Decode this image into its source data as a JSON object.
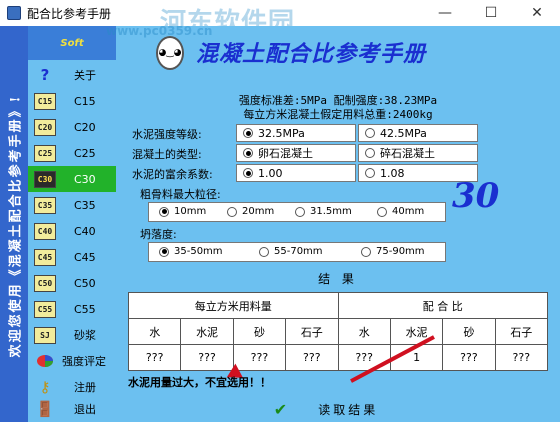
{
  "window": {
    "title": "配合比参考手册",
    "minimize": "—",
    "maximize": "☐",
    "close": "✕"
  },
  "watermark": {
    "text": "河东软件园",
    "url": "www.pc0359.cn"
  },
  "banner": {
    "text": "欢迎您使用《混凝土配合比参考手册》!"
  },
  "logo": {
    "text": "Soft"
  },
  "nav": [
    {
      "icon": "?",
      "label": "关于"
    },
    {
      "icon": "C15",
      "label": "C15"
    },
    {
      "icon": "C20",
      "label": "C20"
    },
    {
      "icon": "C25",
      "label": "C25"
    },
    {
      "icon": "C30",
      "label": "C30"
    },
    {
      "icon": "C35",
      "label": "C35"
    },
    {
      "icon": "C40",
      "label": "C40"
    },
    {
      "icon": "C45",
      "label": "C45"
    },
    {
      "icon": "C50",
      "label": "C50"
    },
    {
      "icon": "C55",
      "label": "C55"
    },
    {
      "icon": "SJ",
      "label": "砂浆"
    },
    {
      "icon": "",
      "label": "强度评定"
    },
    {
      "icon": "",
      "label": "注册"
    },
    {
      "icon": "",
      "label": "退出"
    }
  ],
  "header": {
    "title": "混凝土配合比参考手册"
  },
  "info": {
    "line1": "强度标准差:5MPa  配制强度:38.23MPa",
    "line2": "每立方米混凝土假定用料总重:2400kg"
  },
  "form": {
    "cement_label": "水泥强度等级:",
    "cement_opt1": "32.5MPa",
    "cement_opt2": "42.5MPa",
    "concrete_label": "混凝土的类型:",
    "concrete_opt1": "卵石混凝土",
    "concrete_opt2": "碎石混凝土",
    "rich_label": "水泥的富余系数:",
    "rich_opt1": "1.00",
    "rich_opt2": "1.08",
    "agg_label": "粗骨料最大粒径:",
    "agg_opts": [
      "10mm",
      "20mm",
      "31.5mm",
      "40mm"
    ],
    "slump_label": "坍落度:",
    "slump_opts": [
      "35-50mm",
      "55-70mm",
      "75-90mm"
    ]
  },
  "grade_display": "30",
  "results": {
    "title": "结  果",
    "group_left": "每立方米用料量",
    "group_right": "配  合  比",
    "headers": [
      "水",
      "水泥",
      "砂",
      "石子",
      "水",
      "水泥",
      "砂",
      "石子"
    ],
    "values": [
      "???",
      "???",
      "???",
      "???",
      "???",
      "1",
      "???",
      "???"
    ]
  },
  "message": "水泥用量过大，不宜选用！！",
  "read_button": {
    "icon": "✔",
    "label": "读取结果"
  }
}
